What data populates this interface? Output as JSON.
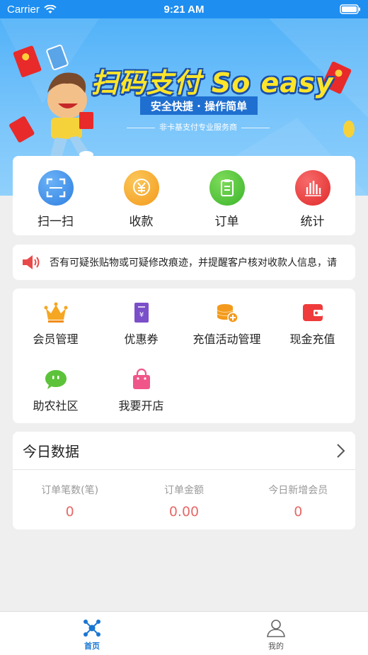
{
  "status_bar": {
    "carrier": "Carrier",
    "time": "9:21 AM"
  },
  "banner": {
    "title": "扫码支付 So easy",
    "ribbon": "安全快捷 · 操作简单",
    "subline": "非卡基支付专业服务商"
  },
  "quick_actions": [
    {
      "label": "扫一扫",
      "icon": "scan-icon",
      "color": "#3d8ee8"
    },
    {
      "label": "收款",
      "icon": "receive-money-icon",
      "color": "#f5a623"
    },
    {
      "label": "订单",
      "icon": "order-clipboard-icon",
      "color": "#4cc33a"
    },
    {
      "label": "统计",
      "icon": "statistics-icon",
      "color": "#ef3b3b"
    }
  ],
  "notice": {
    "icon": "speaker-icon",
    "text": "否有可疑张贴物或可疑修改痕迹，并提醒客户核对收款人信息，请"
  },
  "features": [
    {
      "label": "会员管理",
      "icon": "crown-icon"
    },
    {
      "label": "优惠券",
      "icon": "coupon-icon"
    },
    {
      "label": "充值活动管理",
      "icon": "coins-add-icon"
    },
    {
      "label": "现金充值",
      "icon": "wallet-icon"
    },
    {
      "label": "助农社区",
      "icon": "chat-bubble-icon"
    },
    {
      "label": "我要开店",
      "icon": "shopping-bag-icon"
    }
  ],
  "today_data": {
    "title": "今日数据",
    "stats": [
      {
        "label": "订单笔数(笔)",
        "value": "0"
      },
      {
        "label": "订单金额",
        "value": "0.00"
      },
      {
        "label": "今日新增会员",
        "value": "0"
      }
    ]
  },
  "tab_bar": {
    "tabs": [
      {
        "label": "首页",
        "icon": "home-network-icon",
        "active": true
      },
      {
        "label": "我的",
        "icon": "person-icon",
        "active": false
      }
    ]
  }
}
